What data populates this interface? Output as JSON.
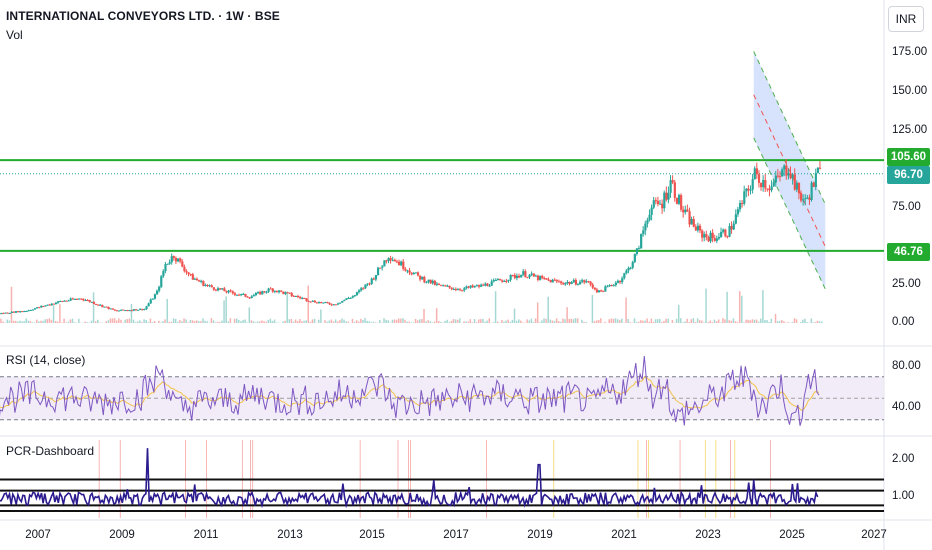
{
  "header": {
    "symbol_title": "INTERNATIONAL CONVEYORS LTD. · 1W · BSE",
    "volume_label": "Vol",
    "currency_button": "INR"
  },
  "panes": {
    "rsi_label": "RSI (14, close)",
    "pcr_label": "PCR-Dashboard"
  },
  "price_axis": {
    "ticks": [
      "175.00",
      "150.00",
      "125.00",
      "75.00",
      "25.00",
      "0.00"
    ]
  },
  "rsi_axis": {
    "ticks": [
      "80.00",
      "40.00"
    ]
  },
  "pcr_axis": {
    "ticks": [
      "2.00",
      "1.00"
    ]
  },
  "badges": {
    "resistance": {
      "text": "105.60",
      "color": "#22ab2e"
    },
    "last_price": {
      "text": "96.70",
      "color": "#26a69a"
    },
    "support": {
      "text": "46.76",
      "color": "#22ab2e"
    }
  },
  "time_axis": {
    "labels": [
      "2007",
      "2009",
      "2011",
      "2013",
      "2015",
      "2017",
      "2019",
      "2021",
      "2023",
      "2025",
      "2027"
    ]
  },
  "colors": {
    "up": "#26a69a",
    "down": "#ef5350",
    "level_line": "#22ab2e",
    "channel_fill": "#c9d9fb",
    "rsi_line": "#7e57c2",
    "rsi_ma": "#f3c34c",
    "pcr_line": "#2a1b8f"
  },
  "chart_data": {
    "type": "line",
    "title": "INTERNATIONAL CONVEYORS LTD. · 1W · BSE",
    "x_range": [
      "2006",
      "2027"
    ],
    "price_axis_range": [
      0,
      175
    ],
    "horizontal_levels": [
      105.6,
      46.76
    ],
    "last_price": 96.7,
    "price_path": [
      {
        "x": 2006.0,
        "y": 6
      },
      {
        "x": 2006.7,
        "y": 8
      },
      {
        "x": 2007.5,
        "y": 14
      },
      {
        "x": 2008.0,
        "y": 16
      },
      {
        "x": 2008.8,
        "y": 8
      },
      {
        "x": 2009.5,
        "y": 9
      },
      {
        "x": 2009.8,
        "y": 20
      },
      {
        "x": 2010.0,
        "y": 38
      },
      {
        "x": 2010.2,
        "y": 44
      },
      {
        "x": 2010.6,
        "y": 30
      },
      {
        "x": 2011.0,
        "y": 24
      },
      {
        "x": 2011.5,
        "y": 20
      },
      {
        "x": 2012.0,
        "y": 17
      },
      {
        "x": 2012.5,
        "y": 22
      },
      {
        "x": 2013.0,
        "y": 18
      },
      {
        "x": 2013.5,
        "y": 14
      },
      {
        "x": 2014.0,
        "y": 12
      },
      {
        "x": 2014.5,
        "y": 18
      },
      {
        "x": 2014.9,
        "y": 28
      },
      {
        "x": 2015.3,
        "y": 44
      },
      {
        "x": 2015.6,
        "y": 38
      },
      {
        "x": 2016.0,
        "y": 30
      },
      {
        "x": 2016.5,
        "y": 24
      },
      {
        "x": 2017.0,
        "y": 22
      },
      {
        "x": 2017.5,
        "y": 24
      },
      {
        "x": 2018.0,
        "y": 28
      },
      {
        "x": 2018.5,
        "y": 32
      },
      {
        "x": 2019.0,
        "y": 28
      },
      {
        "x": 2019.5,
        "y": 26
      },
      {
        "x": 2020.0,
        "y": 27
      },
      {
        "x": 2020.3,
        "y": 20
      },
      {
        "x": 2020.8,
        "y": 28
      },
      {
        "x": 2021.0,
        "y": 35
      },
      {
        "x": 2021.2,
        "y": 46
      },
      {
        "x": 2021.5,
        "y": 74
      },
      {
        "x": 2021.8,
        "y": 78
      },
      {
        "x": 2022.0,
        "y": 92
      },
      {
        "x": 2022.3,
        "y": 72
      },
      {
        "x": 2022.7,
        "y": 58
      },
      {
        "x": 2023.0,
        "y": 55
      },
      {
        "x": 2023.4,
        "y": 60
      },
      {
        "x": 2023.7,
        "y": 78
      },
      {
        "x": 2024.0,
        "y": 96
      },
      {
        "x": 2024.4,
        "y": 88
      },
      {
        "x": 2024.8,
        "y": 102
      },
      {
        "x": 2025.0,
        "y": 86
      },
      {
        "x": 2025.2,
        "y": 78
      },
      {
        "x": 2025.5,
        "y": 96.7
      }
    ],
    "descending_channel": {
      "upper": [
        {
          "x": 2024.0,
          "y": 176
        },
        {
          "x": 2025.7,
          "y": 77
        }
      ],
      "lower": [
        {
          "x": 2024.0,
          "y": 120
        },
        {
          "x": 2025.7,
          "y": 22
        }
      ]
    },
    "rsi_range": [
      20,
      95
    ],
    "rsi_band": [
      70,
      30
    ],
    "pcr_range": [
      0.5,
      2.5
    ],
    "pcr_levels": [
      1.5,
      1.2,
      0.8,
      0.65
    ]
  }
}
